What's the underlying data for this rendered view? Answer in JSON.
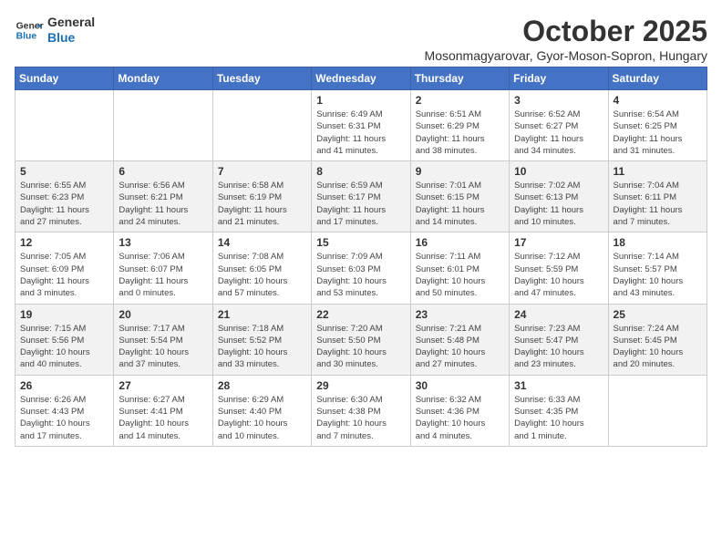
{
  "header": {
    "logo_line1": "General",
    "logo_line2": "Blue",
    "month_title": "October 2025",
    "location": "Mosonmagyarovar, Gyor-Moson-Sopron, Hungary"
  },
  "weekdays": [
    "Sunday",
    "Monday",
    "Tuesday",
    "Wednesday",
    "Thursday",
    "Friday",
    "Saturday"
  ],
  "weeks": [
    [
      {
        "day": "",
        "info": ""
      },
      {
        "day": "",
        "info": ""
      },
      {
        "day": "",
        "info": ""
      },
      {
        "day": "1",
        "info": "Sunrise: 6:49 AM\nSunset: 6:31 PM\nDaylight: 11 hours\nand 41 minutes."
      },
      {
        "day": "2",
        "info": "Sunrise: 6:51 AM\nSunset: 6:29 PM\nDaylight: 11 hours\nand 38 minutes."
      },
      {
        "day": "3",
        "info": "Sunrise: 6:52 AM\nSunset: 6:27 PM\nDaylight: 11 hours\nand 34 minutes."
      },
      {
        "day": "4",
        "info": "Sunrise: 6:54 AM\nSunset: 6:25 PM\nDaylight: 11 hours\nand 31 minutes."
      }
    ],
    [
      {
        "day": "5",
        "info": "Sunrise: 6:55 AM\nSunset: 6:23 PM\nDaylight: 11 hours\nand 27 minutes."
      },
      {
        "day": "6",
        "info": "Sunrise: 6:56 AM\nSunset: 6:21 PM\nDaylight: 11 hours\nand 24 minutes."
      },
      {
        "day": "7",
        "info": "Sunrise: 6:58 AM\nSunset: 6:19 PM\nDaylight: 11 hours\nand 21 minutes."
      },
      {
        "day": "8",
        "info": "Sunrise: 6:59 AM\nSunset: 6:17 PM\nDaylight: 11 hours\nand 17 minutes."
      },
      {
        "day": "9",
        "info": "Sunrise: 7:01 AM\nSunset: 6:15 PM\nDaylight: 11 hours\nand 14 minutes."
      },
      {
        "day": "10",
        "info": "Sunrise: 7:02 AM\nSunset: 6:13 PM\nDaylight: 11 hours\nand 10 minutes."
      },
      {
        "day": "11",
        "info": "Sunrise: 7:04 AM\nSunset: 6:11 PM\nDaylight: 11 hours\nand 7 minutes."
      }
    ],
    [
      {
        "day": "12",
        "info": "Sunrise: 7:05 AM\nSunset: 6:09 PM\nDaylight: 11 hours\nand 3 minutes."
      },
      {
        "day": "13",
        "info": "Sunrise: 7:06 AM\nSunset: 6:07 PM\nDaylight: 11 hours\nand 0 minutes."
      },
      {
        "day": "14",
        "info": "Sunrise: 7:08 AM\nSunset: 6:05 PM\nDaylight: 10 hours\nand 57 minutes."
      },
      {
        "day": "15",
        "info": "Sunrise: 7:09 AM\nSunset: 6:03 PM\nDaylight: 10 hours\nand 53 minutes."
      },
      {
        "day": "16",
        "info": "Sunrise: 7:11 AM\nSunset: 6:01 PM\nDaylight: 10 hours\nand 50 minutes."
      },
      {
        "day": "17",
        "info": "Sunrise: 7:12 AM\nSunset: 5:59 PM\nDaylight: 10 hours\nand 47 minutes."
      },
      {
        "day": "18",
        "info": "Sunrise: 7:14 AM\nSunset: 5:57 PM\nDaylight: 10 hours\nand 43 minutes."
      }
    ],
    [
      {
        "day": "19",
        "info": "Sunrise: 7:15 AM\nSunset: 5:56 PM\nDaylight: 10 hours\nand 40 minutes."
      },
      {
        "day": "20",
        "info": "Sunrise: 7:17 AM\nSunset: 5:54 PM\nDaylight: 10 hours\nand 37 minutes."
      },
      {
        "day": "21",
        "info": "Sunrise: 7:18 AM\nSunset: 5:52 PM\nDaylight: 10 hours\nand 33 minutes."
      },
      {
        "day": "22",
        "info": "Sunrise: 7:20 AM\nSunset: 5:50 PM\nDaylight: 10 hours\nand 30 minutes."
      },
      {
        "day": "23",
        "info": "Sunrise: 7:21 AM\nSunset: 5:48 PM\nDaylight: 10 hours\nand 27 minutes."
      },
      {
        "day": "24",
        "info": "Sunrise: 7:23 AM\nSunset: 5:47 PM\nDaylight: 10 hours\nand 23 minutes."
      },
      {
        "day": "25",
        "info": "Sunrise: 7:24 AM\nSunset: 5:45 PM\nDaylight: 10 hours\nand 20 minutes."
      }
    ],
    [
      {
        "day": "26",
        "info": "Sunrise: 6:26 AM\nSunset: 4:43 PM\nDaylight: 10 hours\nand 17 minutes."
      },
      {
        "day": "27",
        "info": "Sunrise: 6:27 AM\nSunset: 4:41 PM\nDaylight: 10 hours\nand 14 minutes."
      },
      {
        "day": "28",
        "info": "Sunrise: 6:29 AM\nSunset: 4:40 PM\nDaylight: 10 hours\nand 10 minutes."
      },
      {
        "day": "29",
        "info": "Sunrise: 6:30 AM\nSunset: 4:38 PM\nDaylight: 10 hours\nand 7 minutes."
      },
      {
        "day": "30",
        "info": "Sunrise: 6:32 AM\nSunset: 4:36 PM\nDaylight: 10 hours\nand 4 minutes."
      },
      {
        "day": "31",
        "info": "Sunrise: 6:33 AM\nSunset: 4:35 PM\nDaylight: 10 hours\nand 1 minute."
      },
      {
        "day": "",
        "info": ""
      }
    ]
  ]
}
